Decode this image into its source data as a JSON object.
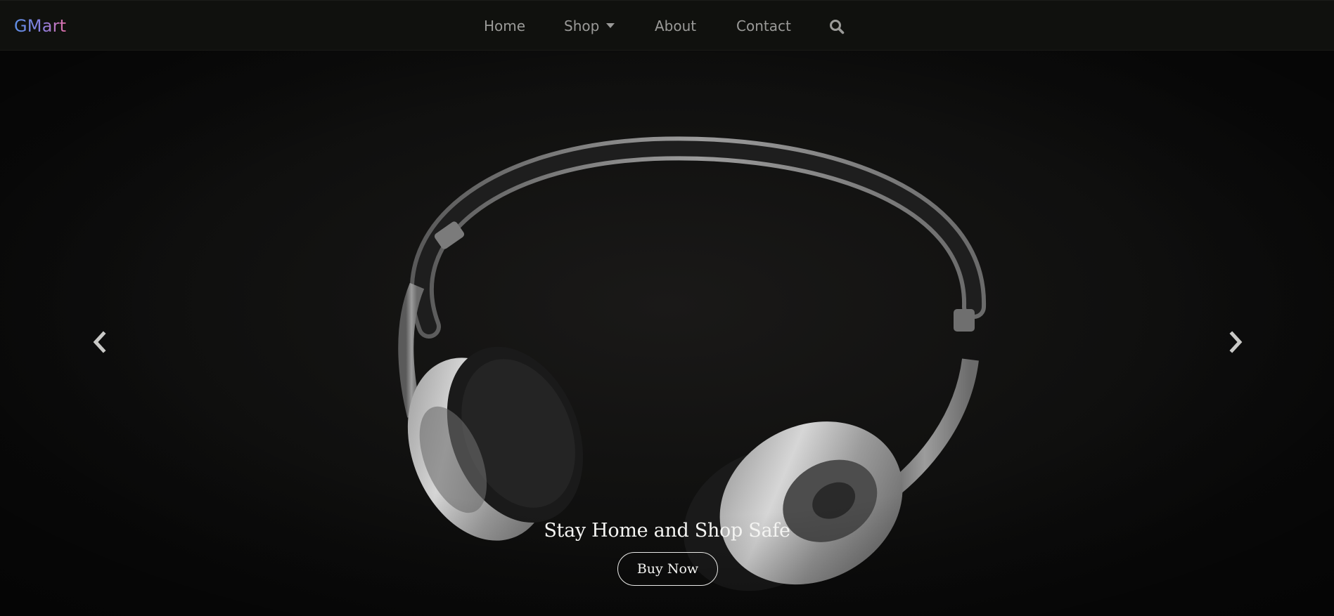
{
  "brand": {
    "name": "GMart"
  },
  "nav": {
    "home": "Home",
    "shop": "Shop",
    "about": "About",
    "contact": "Contact",
    "search_icon": "search-icon"
  },
  "hero": {
    "caption": "Stay Home and Shop Safe",
    "button_label": "Buy Now",
    "prev_icon": "chevron-left-icon",
    "next_icon": "chevron-right-icon"
  },
  "colors": {
    "navbar_bg": "#10110e",
    "hero_bg": "#111110",
    "nav_text": "#9a9a98",
    "brand_gradient_start": "#5d8fe6",
    "brand_gradient_end": "#e36fa8",
    "caption_text": "#f4f4f2"
  }
}
